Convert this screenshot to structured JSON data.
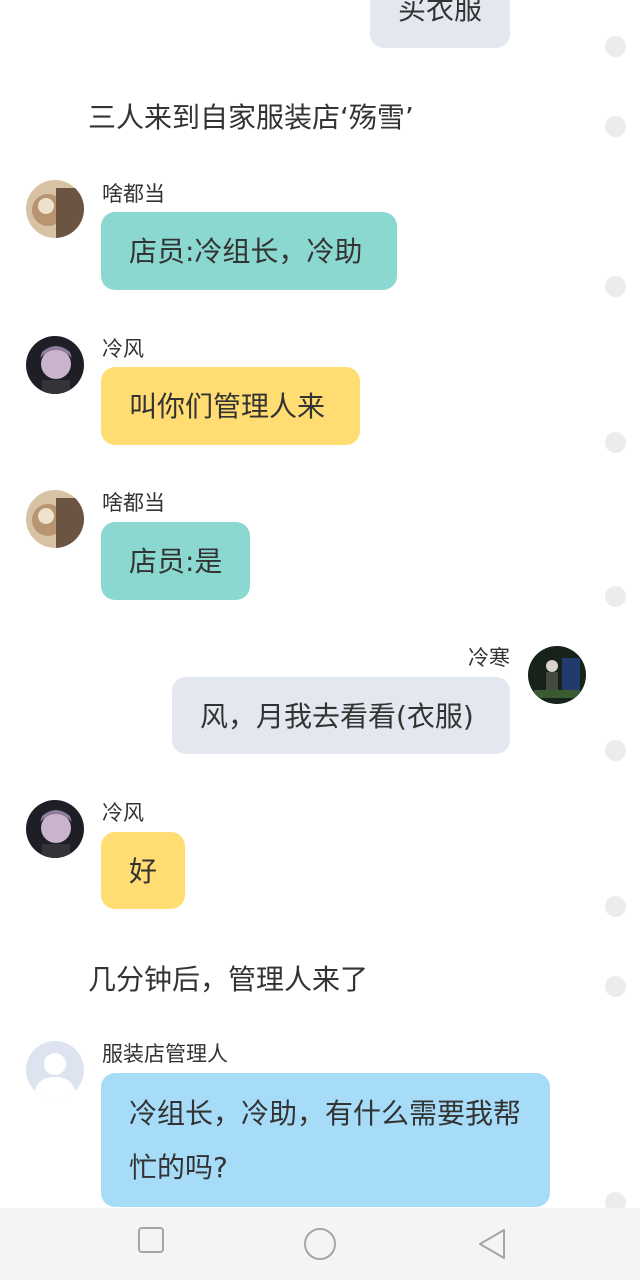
{
  "colors": {
    "teal_bubble": "#8bd8d0",
    "yellow_bubble": "#ffdd72",
    "grey_bubble": "#e3e8f0",
    "blue_bubble": "#a6dcf8",
    "dot": "#ececec",
    "navbar_bg": "#f4f4f4"
  },
  "messages": {
    "top_partial": {
      "text": "买衣服"
    },
    "narration_1": "三人来到自家服装店‘殇雪’",
    "msg_1": {
      "name": "啥都当",
      "text": "店员:冷组长，冷助"
    },
    "msg_2": {
      "name": "冷风",
      "text": "叫你们管理人来"
    },
    "msg_3": {
      "name": "啥都当",
      "text": "店员:是"
    },
    "msg_4": {
      "name": "冷寒",
      "text": "风，月我去看看(衣服)"
    },
    "msg_5": {
      "name": "冷风",
      "text": "好"
    },
    "narration_2": "几分钟后，管理人来了",
    "msg_6": {
      "name": "服装店管理人",
      "text": "冷组长，冷助，有什么需要我帮忙的吗?"
    }
  },
  "navbar": {
    "icons": [
      "square-recent-icon",
      "circle-home-icon",
      "triangle-back-icon"
    ]
  }
}
